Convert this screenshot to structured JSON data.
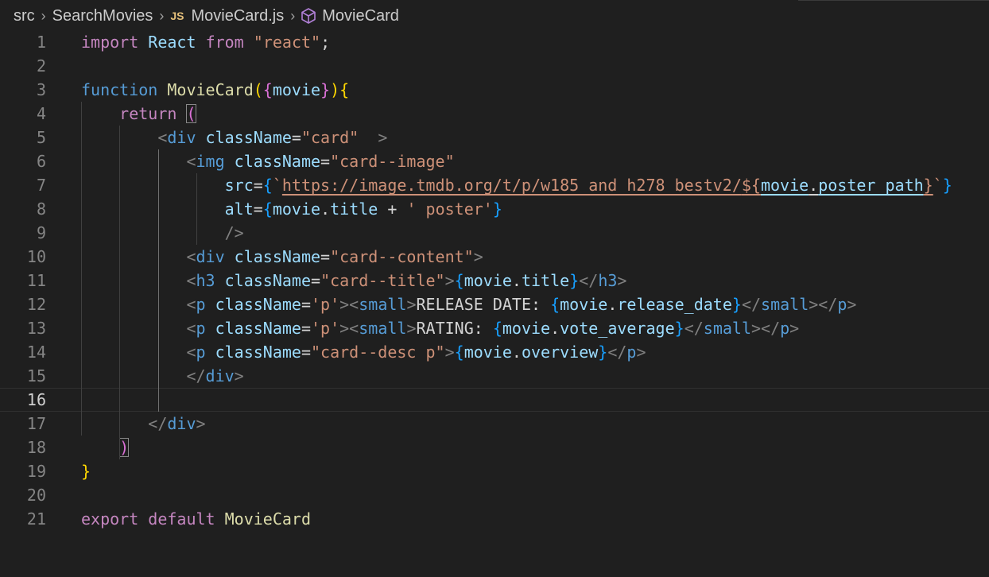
{
  "breadcrumb": {
    "items": [
      "src",
      "SearchMovies",
      "MovieCard.js",
      "MovieCard"
    ],
    "js_badge": "JS"
  },
  "editor": {
    "current_line": 16,
    "lines": [
      {
        "n": "1",
        "tokens": [
          [
            "kw",
            "import"
          ],
          [
            "txt",
            " "
          ],
          [
            "var",
            "React"
          ],
          [
            "txt",
            " "
          ],
          [
            "kw",
            "from"
          ],
          [
            "txt",
            " "
          ],
          [
            "str",
            "\"react\""
          ],
          [
            "txt",
            ";"
          ]
        ]
      },
      {
        "n": "2",
        "tokens": []
      },
      {
        "n": "3",
        "tokens": [
          [
            "st",
            "function"
          ],
          [
            "txt",
            " "
          ],
          [
            "fn",
            "MovieCard"
          ],
          [
            "br1",
            "("
          ],
          [
            "br2",
            "{"
          ],
          [
            "var",
            "movie"
          ],
          [
            "br2",
            "}"
          ],
          [
            "br1",
            ")"
          ],
          [
            "br1",
            "{"
          ]
        ]
      },
      {
        "n": "4",
        "tokens": [
          [
            "txt",
            "    "
          ],
          [
            "kw",
            "return"
          ],
          [
            "txt",
            " "
          ],
          [
            "br2 match",
            "("
          ]
        ]
      },
      {
        "n": "5",
        "tokens": [
          [
            "txt",
            "        "
          ],
          [
            "pun",
            "<"
          ],
          [
            "tag",
            "div"
          ],
          [
            "txt",
            " "
          ],
          [
            "var",
            "className"
          ],
          [
            "txt",
            "="
          ],
          [
            "str",
            "\"card\""
          ],
          [
            "txt",
            "  "
          ],
          [
            "pun",
            ">"
          ]
        ]
      },
      {
        "n": "6",
        "tokens": [
          [
            "txt",
            "           "
          ],
          [
            "pun",
            "<"
          ],
          [
            "tag",
            "img"
          ],
          [
            "txt",
            " "
          ],
          [
            "var",
            "className"
          ],
          [
            "txt",
            "="
          ],
          [
            "str",
            "\"card--image\""
          ]
        ]
      },
      {
        "n": "7",
        "tokens": [
          [
            "txt",
            "               "
          ],
          [
            "var",
            "src"
          ],
          [
            "txt",
            "="
          ],
          [
            "br3",
            "{"
          ],
          [
            "str",
            "`"
          ],
          [
            "url",
            "https://image.tmdb.org/t/p/w185_and_h278_bestv2/"
          ],
          [
            "str ul",
            "${"
          ],
          [
            "var ul",
            "movie"
          ],
          [
            "txt ul",
            "."
          ],
          [
            "var ul",
            "poster_path"
          ],
          [
            "str ul",
            "}"
          ],
          [
            "str",
            "`"
          ],
          [
            "br3",
            "}"
          ]
        ]
      },
      {
        "n": "8",
        "tokens": [
          [
            "txt",
            "               "
          ],
          [
            "var",
            "alt"
          ],
          [
            "txt",
            "="
          ],
          [
            "br3",
            "{"
          ],
          [
            "var",
            "movie"
          ],
          [
            "txt",
            "."
          ],
          [
            "var",
            "title"
          ],
          [
            "txt",
            " + "
          ],
          [
            "str",
            "' poster'"
          ],
          [
            "br3",
            "}"
          ]
        ]
      },
      {
        "n": "9",
        "tokens": [
          [
            "txt",
            "               "
          ],
          [
            "pun",
            "/>"
          ]
        ]
      },
      {
        "n": "10",
        "tokens": [
          [
            "txt",
            "           "
          ],
          [
            "pun",
            "<"
          ],
          [
            "tag",
            "div"
          ],
          [
            "txt",
            " "
          ],
          [
            "var",
            "className"
          ],
          [
            "txt",
            "="
          ],
          [
            "str",
            "\"card--content\""
          ],
          [
            "pun",
            ">"
          ]
        ]
      },
      {
        "n": "11",
        "tokens": [
          [
            "txt",
            "           "
          ],
          [
            "pun",
            "<"
          ],
          [
            "tag",
            "h3"
          ],
          [
            "txt",
            " "
          ],
          [
            "var",
            "className"
          ],
          [
            "txt",
            "="
          ],
          [
            "str",
            "\"card--title\""
          ],
          [
            "pun",
            ">"
          ],
          [
            "br3",
            "{"
          ],
          [
            "var",
            "movie"
          ],
          [
            "txt",
            "."
          ],
          [
            "var",
            "title"
          ],
          [
            "br3",
            "}"
          ],
          [
            "pun",
            "</"
          ],
          [
            "tag",
            "h3"
          ],
          [
            "pun",
            ">"
          ]
        ]
      },
      {
        "n": "12",
        "tokens": [
          [
            "txt",
            "           "
          ],
          [
            "pun",
            "<"
          ],
          [
            "tag",
            "p"
          ],
          [
            "txt",
            " "
          ],
          [
            "var",
            "className"
          ],
          [
            "txt",
            "="
          ],
          [
            "str",
            "'p'"
          ],
          [
            "pun",
            "><"
          ],
          [
            "tag",
            "small"
          ],
          [
            "pun",
            ">"
          ],
          [
            "txt",
            "RELEASE DATE: "
          ],
          [
            "br3",
            "{"
          ],
          [
            "var",
            "movie"
          ],
          [
            "txt",
            "."
          ],
          [
            "var",
            "release_date"
          ],
          [
            "br3",
            "}"
          ],
          [
            "pun",
            "</"
          ],
          [
            "tag",
            "small"
          ],
          [
            "pun",
            "></"
          ],
          [
            "tag",
            "p"
          ],
          [
            "pun",
            ">"
          ]
        ]
      },
      {
        "n": "13",
        "tokens": [
          [
            "txt",
            "           "
          ],
          [
            "pun",
            "<"
          ],
          [
            "tag",
            "p"
          ],
          [
            "txt",
            " "
          ],
          [
            "var",
            "className"
          ],
          [
            "txt",
            "="
          ],
          [
            "str",
            "'p'"
          ],
          [
            "pun",
            "><"
          ],
          [
            "tag",
            "small"
          ],
          [
            "pun",
            ">"
          ],
          [
            "txt",
            "RATING: "
          ],
          [
            "br3",
            "{"
          ],
          [
            "var",
            "movie"
          ],
          [
            "txt",
            "."
          ],
          [
            "var",
            "vote_average"
          ],
          [
            "br3",
            "}"
          ],
          [
            "pun",
            "</"
          ],
          [
            "tag",
            "small"
          ],
          [
            "pun",
            "></"
          ],
          [
            "tag",
            "p"
          ],
          [
            "pun",
            ">"
          ]
        ]
      },
      {
        "n": "14",
        "tokens": [
          [
            "txt",
            "           "
          ],
          [
            "pun",
            "<"
          ],
          [
            "tag",
            "p"
          ],
          [
            "txt",
            " "
          ],
          [
            "var",
            "className"
          ],
          [
            "txt",
            "="
          ],
          [
            "str",
            "\"card--desc p\""
          ],
          [
            "pun",
            ">"
          ],
          [
            "br3",
            "{"
          ],
          [
            "var",
            "movie"
          ],
          [
            "txt",
            "."
          ],
          [
            "var",
            "overview"
          ],
          [
            "br3",
            "}"
          ],
          [
            "pun",
            "</"
          ],
          [
            "tag",
            "p"
          ],
          [
            "pun",
            ">"
          ]
        ]
      },
      {
        "n": "15",
        "tokens": [
          [
            "txt",
            "           "
          ],
          [
            "pun",
            "</"
          ],
          [
            "tag",
            "div"
          ],
          [
            "pun",
            ">"
          ]
        ]
      },
      {
        "n": "16",
        "tokens": []
      },
      {
        "n": "17",
        "tokens": [
          [
            "txt",
            "       "
          ],
          [
            "pun",
            "</"
          ],
          [
            "tag",
            "div"
          ],
          [
            "pun",
            ">"
          ]
        ]
      },
      {
        "n": "18",
        "tokens": [
          [
            "txt",
            "    "
          ],
          [
            "br2 match",
            ")"
          ]
        ]
      },
      {
        "n": "19",
        "tokens": [
          [
            "br1",
            "}"
          ]
        ]
      },
      {
        "n": "20",
        "tokens": []
      },
      {
        "n": "21",
        "tokens": [
          [
            "kw",
            "export"
          ],
          [
            "txt",
            " "
          ],
          [
            "kw",
            "default"
          ],
          [
            "txt",
            " "
          ],
          [
            "fn",
            "MovieCard"
          ]
        ]
      }
    ]
  }
}
